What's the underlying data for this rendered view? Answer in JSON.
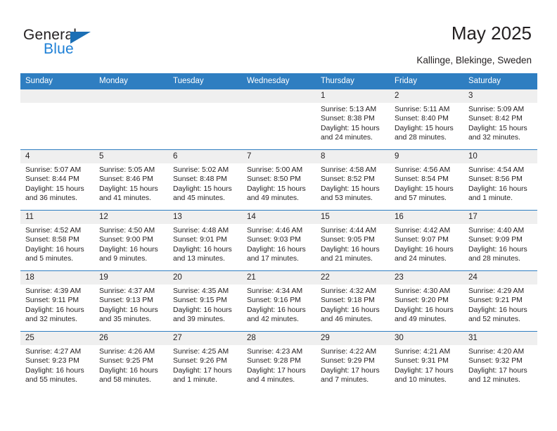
{
  "logo": {
    "name_top": "General",
    "name_bottom": "Blue",
    "triangle_color": "#1c6fb5",
    "blue_color": "#1c7fd6"
  },
  "header": {
    "title": "May 2025",
    "subtitle": "Kallinge, Blekinge, Sweden",
    "accent_color": "#2f7ec1",
    "daynum_bg": "#efefef"
  },
  "weekday_headers": [
    "Sunday",
    "Monday",
    "Tuesday",
    "Wednesday",
    "Thursday",
    "Friday",
    "Saturday"
  ],
  "weeks": [
    [
      {
        "day": "",
        "blank": true
      },
      {
        "day": "",
        "blank": true
      },
      {
        "day": "",
        "blank": true
      },
      {
        "day": "",
        "blank": true
      },
      {
        "day": "1",
        "sunrise": "Sunrise: 5:13 AM",
        "sunset": "Sunset: 8:38 PM",
        "daylight": "Daylight: 15 hours and 24 minutes."
      },
      {
        "day": "2",
        "sunrise": "Sunrise: 5:11 AM",
        "sunset": "Sunset: 8:40 PM",
        "daylight": "Daylight: 15 hours and 28 minutes."
      },
      {
        "day": "3",
        "sunrise": "Sunrise: 5:09 AM",
        "sunset": "Sunset: 8:42 PM",
        "daylight": "Daylight: 15 hours and 32 minutes."
      }
    ],
    [
      {
        "day": "4",
        "sunrise": "Sunrise: 5:07 AM",
        "sunset": "Sunset: 8:44 PM",
        "daylight": "Daylight: 15 hours and 36 minutes."
      },
      {
        "day": "5",
        "sunrise": "Sunrise: 5:05 AM",
        "sunset": "Sunset: 8:46 PM",
        "daylight": "Daylight: 15 hours and 41 minutes."
      },
      {
        "day": "6",
        "sunrise": "Sunrise: 5:02 AM",
        "sunset": "Sunset: 8:48 PM",
        "daylight": "Daylight: 15 hours and 45 minutes."
      },
      {
        "day": "7",
        "sunrise": "Sunrise: 5:00 AM",
        "sunset": "Sunset: 8:50 PM",
        "daylight": "Daylight: 15 hours and 49 minutes."
      },
      {
        "day": "8",
        "sunrise": "Sunrise: 4:58 AM",
        "sunset": "Sunset: 8:52 PM",
        "daylight": "Daylight: 15 hours and 53 minutes."
      },
      {
        "day": "9",
        "sunrise": "Sunrise: 4:56 AM",
        "sunset": "Sunset: 8:54 PM",
        "daylight": "Daylight: 15 hours and 57 minutes."
      },
      {
        "day": "10",
        "sunrise": "Sunrise: 4:54 AM",
        "sunset": "Sunset: 8:56 PM",
        "daylight": "Daylight: 16 hours and 1 minute."
      }
    ],
    [
      {
        "day": "11",
        "sunrise": "Sunrise: 4:52 AM",
        "sunset": "Sunset: 8:58 PM",
        "daylight": "Daylight: 16 hours and 5 minutes."
      },
      {
        "day": "12",
        "sunrise": "Sunrise: 4:50 AM",
        "sunset": "Sunset: 9:00 PM",
        "daylight": "Daylight: 16 hours and 9 minutes."
      },
      {
        "day": "13",
        "sunrise": "Sunrise: 4:48 AM",
        "sunset": "Sunset: 9:01 PM",
        "daylight": "Daylight: 16 hours and 13 minutes."
      },
      {
        "day": "14",
        "sunrise": "Sunrise: 4:46 AM",
        "sunset": "Sunset: 9:03 PM",
        "daylight": "Daylight: 16 hours and 17 minutes."
      },
      {
        "day": "15",
        "sunrise": "Sunrise: 4:44 AM",
        "sunset": "Sunset: 9:05 PM",
        "daylight": "Daylight: 16 hours and 21 minutes."
      },
      {
        "day": "16",
        "sunrise": "Sunrise: 4:42 AM",
        "sunset": "Sunset: 9:07 PM",
        "daylight": "Daylight: 16 hours and 24 minutes."
      },
      {
        "day": "17",
        "sunrise": "Sunrise: 4:40 AM",
        "sunset": "Sunset: 9:09 PM",
        "daylight": "Daylight: 16 hours and 28 minutes."
      }
    ],
    [
      {
        "day": "18",
        "sunrise": "Sunrise: 4:39 AM",
        "sunset": "Sunset: 9:11 PM",
        "daylight": "Daylight: 16 hours and 32 minutes."
      },
      {
        "day": "19",
        "sunrise": "Sunrise: 4:37 AM",
        "sunset": "Sunset: 9:13 PM",
        "daylight": "Daylight: 16 hours and 35 minutes."
      },
      {
        "day": "20",
        "sunrise": "Sunrise: 4:35 AM",
        "sunset": "Sunset: 9:15 PM",
        "daylight": "Daylight: 16 hours and 39 minutes."
      },
      {
        "day": "21",
        "sunrise": "Sunrise: 4:34 AM",
        "sunset": "Sunset: 9:16 PM",
        "daylight": "Daylight: 16 hours and 42 minutes."
      },
      {
        "day": "22",
        "sunrise": "Sunrise: 4:32 AM",
        "sunset": "Sunset: 9:18 PM",
        "daylight": "Daylight: 16 hours and 46 minutes."
      },
      {
        "day": "23",
        "sunrise": "Sunrise: 4:30 AM",
        "sunset": "Sunset: 9:20 PM",
        "daylight": "Daylight: 16 hours and 49 minutes."
      },
      {
        "day": "24",
        "sunrise": "Sunrise: 4:29 AM",
        "sunset": "Sunset: 9:21 PM",
        "daylight": "Daylight: 16 hours and 52 minutes."
      }
    ],
    [
      {
        "day": "25",
        "sunrise": "Sunrise: 4:27 AM",
        "sunset": "Sunset: 9:23 PM",
        "daylight": "Daylight: 16 hours and 55 minutes."
      },
      {
        "day": "26",
        "sunrise": "Sunrise: 4:26 AM",
        "sunset": "Sunset: 9:25 PM",
        "daylight": "Daylight: 16 hours and 58 minutes."
      },
      {
        "day": "27",
        "sunrise": "Sunrise: 4:25 AM",
        "sunset": "Sunset: 9:26 PM",
        "daylight": "Daylight: 17 hours and 1 minute."
      },
      {
        "day": "28",
        "sunrise": "Sunrise: 4:23 AM",
        "sunset": "Sunset: 9:28 PM",
        "daylight": "Daylight: 17 hours and 4 minutes."
      },
      {
        "day": "29",
        "sunrise": "Sunrise: 4:22 AM",
        "sunset": "Sunset: 9:29 PM",
        "daylight": "Daylight: 17 hours and 7 minutes."
      },
      {
        "day": "30",
        "sunrise": "Sunrise: 4:21 AM",
        "sunset": "Sunset: 9:31 PM",
        "daylight": "Daylight: 17 hours and 10 minutes."
      },
      {
        "day": "31",
        "sunrise": "Sunrise: 4:20 AM",
        "sunset": "Sunset: 9:32 PM",
        "daylight": "Daylight: 17 hours and 12 minutes."
      }
    ]
  ]
}
